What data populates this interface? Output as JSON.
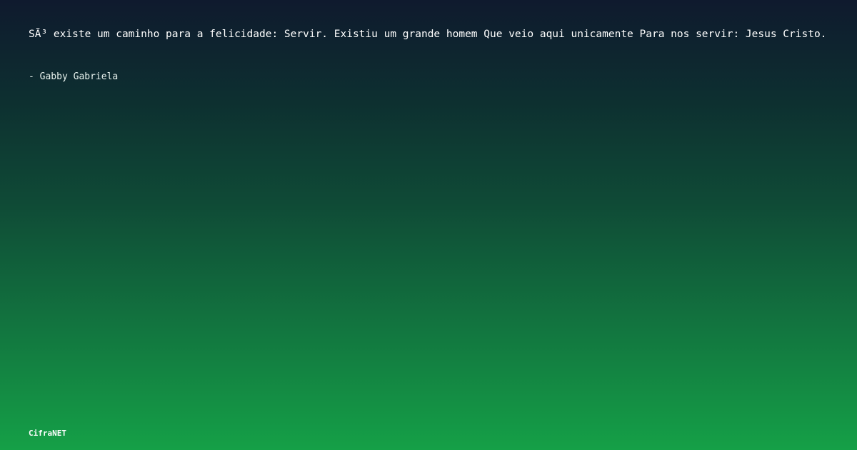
{
  "quote": {
    "text": "SÃ³ existe um caminho para a felicidade: Servir. Existiu um grande homem Que veio aqui unicamente Para nos servir: Jesus Cristo."
  },
  "author": {
    "text": "- Gabby Gabriela"
  },
  "brand": {
    "name": "CifraNET"
  },
  "colors": {
    "gradient_top": "#0f1a2e",
    "gradient_bottom": "#15a047",
    "text": "#ffffff"
  }
}
